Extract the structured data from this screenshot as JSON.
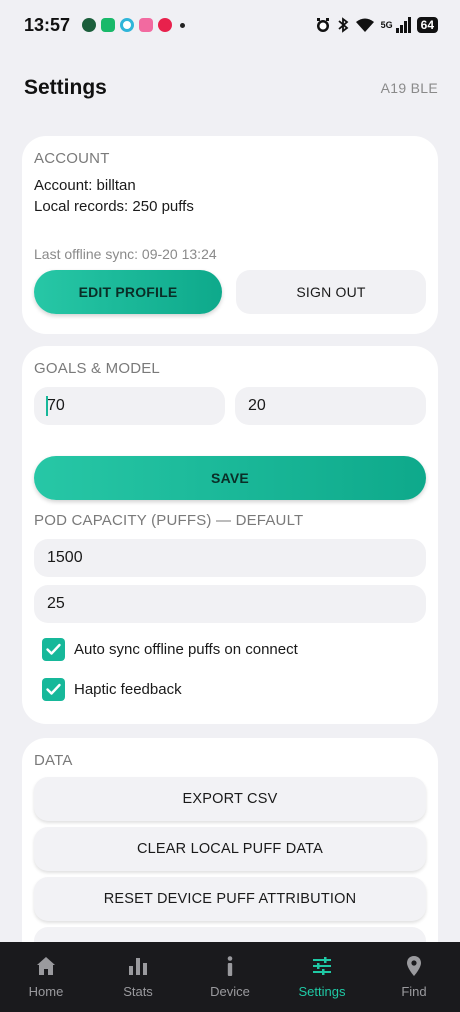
{
  "status_bar": {
    "time": "13:57",
    "network": "5G",
    "battery": "64"
  },
  "header": {
    "title": "Settings",
    "device": "A19 BLE"
  },
  "account": {
    "section_title": "ACCOUNT",
    "account_line": "Account: billtan",
    "records_line": "Local records: 250 puffs",
    "last_sync": "Last offline sync: 09-20 13:24",
    "edit_profile_label": "EDIT PROFILE",
    "sign_out_label": "SIGN OUT"
  },
  "goals": {
    "section_title": "GOALS & MODEL",
    "goal_value_1": "70",
    "goal_value_2": "20",
    "save_label": "SAVE",
    "capacity_title": "POD CAPACITY (PUFFS) — DEFAULT",
    "capacity_value": "1500",
    "second_value": "25",
    "auto_sync_label": "Auto sync offline puffs on connect",
    "auto_sync_checked": true,
    "haptic_label": "Haptic feedback",
    "haptic_checked": true
  },
  "data_section": {
    "section_title": "DATA",
    "export_label": "EXPORT CSV",
    "clear_label": "CLEAR LOCAL PUFF DATA",
    "reset_label": "RESET DEVICE PUFF ATTRIBUTION"
  },
  "nav": {
    "items": [
      {
        "label": "Home",
        "icon": "home-icon"
      },
      {
        "label": "Stats",
        "icon": "bar-chart-icon"
      },
      {
        "label": "Device",
        "icon": "device-icon"
      },
      {
        "label": "Settings",
        "icon": "sliders-icon"
      },
      {
        "label": "Find",
        "icon": "location-pin-icon"
      }
    ],
    "active": "Settings",
    "active_color": "#1fc9a5"
  },
  "colors": {
    "accent": "#17b89a",
    "background": "#f0f0f4",
    "nav_background": "#1a1a1d"
  }
}
